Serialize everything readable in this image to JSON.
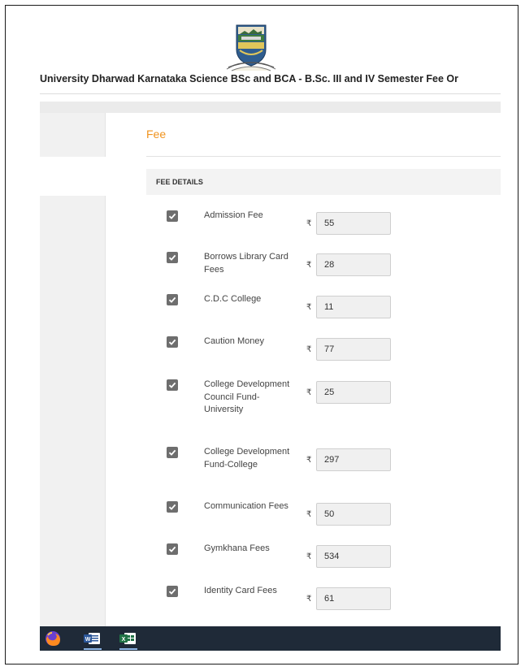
{
  "header": {
    "site_title": "University Dharwad Karnataka Science BSc and BCA - B.Sc. III and IV Semester Fee Or"
  },
  "form": {
    "section_title": "Fee",
    "details_label": "FEE DETAILS",
    "currency_symbol": "₹",
    "items": [
      {
        "label": "Admission Fee",
        "amount": "55",
        "checked": true
      },
      {
        "label": "Borrows Library Card Fees",
        "amount": "28",
        "checked": true
      },
      {
        "label": "C.D.C College",
        "amount": "11",
        "checked": true
      },
      {
        "label": "Caution Money",
        "amount": "77",
        "checked": true
      },
      {
        "label": "College Development Council Fund-University",
        "amount": "25",
        "checked": true
      },
      {
        "label": "College Development Fund-College",
        "amount": "297",
        "checked": true
      },
      {
        "label": "Communication Fees",
        "amount": "50",
        "checked": true
      },
      {
        "label": "Gymkhana Fees",
        "amount": "534",
        "checked": true
      },
      {
        "label": "Identity Card Fees",
        "amount": "61",
        "checked": true
      }
    ]
  },
  "taskbar": {
    "apps": [
      {
        "name": "firefox-icon"
      },
      {
        "name": "word-icon"
      },
      {
        "name": "excel-icon"
      }
    ]
  },
  "colors": {
    "accent": "#f0931e",
    "taskbar": "#1f2a38",
    "checkbox": "#6e6e6e"
  }
}
